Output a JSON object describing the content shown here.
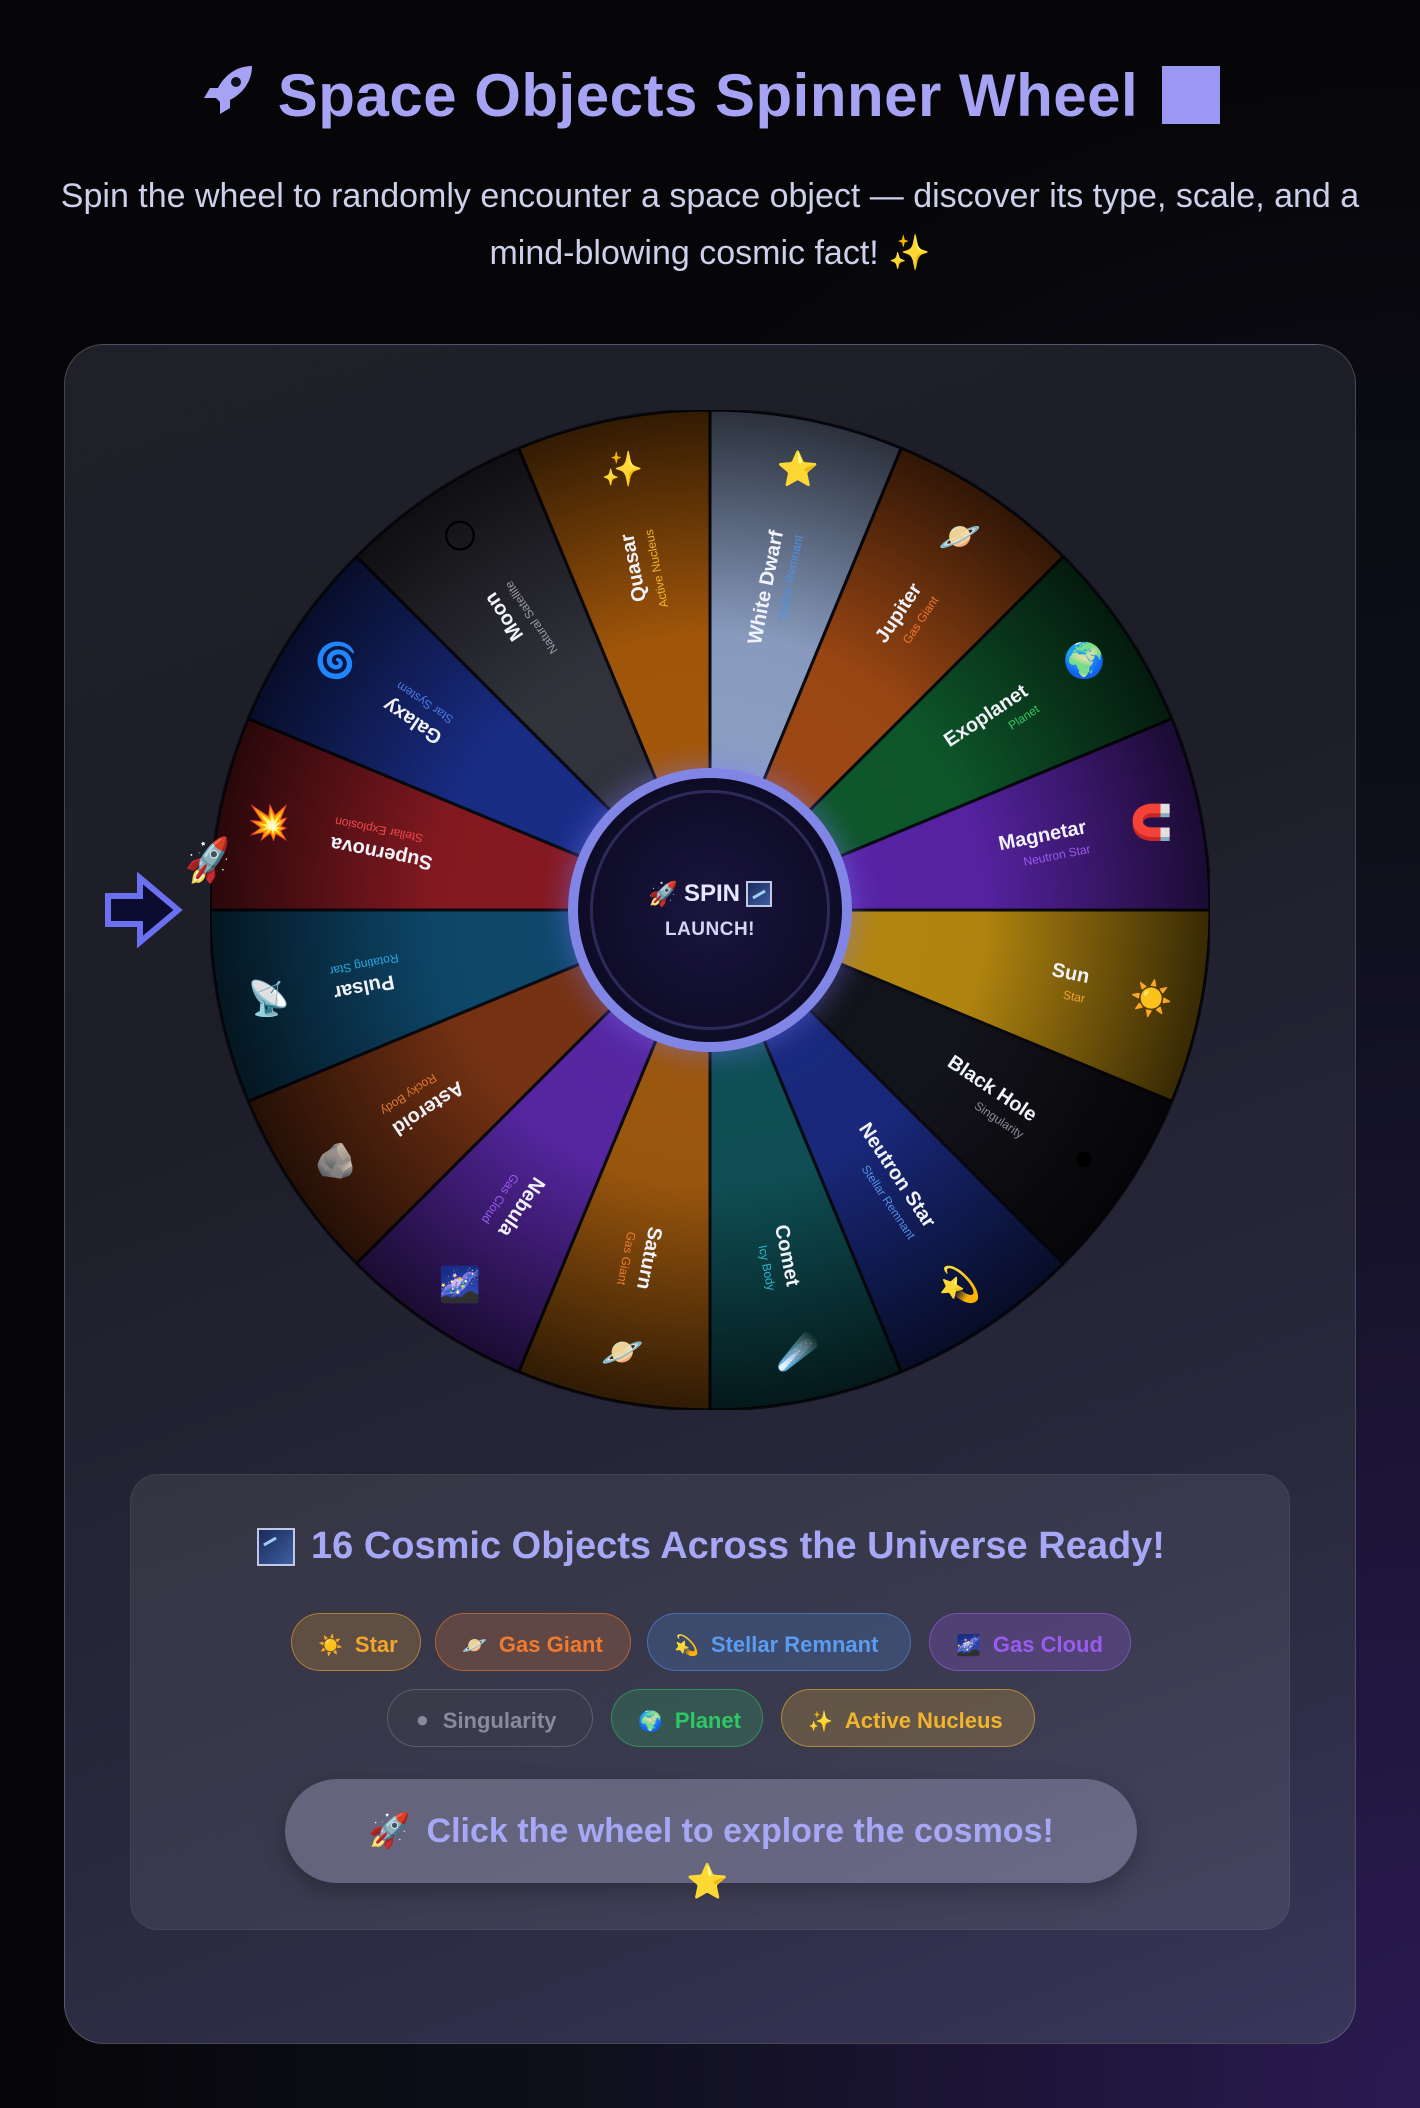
{
  "header": {
    "title_icon": "rocket-icon",
    "title": "Space Objects Spinner Wheel",
    "subtitle": "Spin the wheel to randomly encounter a space object — discover its type, scale, and a mind-blowing cosmic fact! ✨"
  },
  "wheel": {
    "segments": [
      {
        "name": "White Dwarf",
        "type": "Stellar Remnant",
        "icon": "⭐",
        "color": "#8fa3c8",
        "type_color": "#4e8fe6"
      },
      {
        "name": "Jupiter",
        "type": "Gas Giant",
        "icon": "🪐",
        "color": "#a24a14",
        "type_color": "#f07a2e"
      },
      {
        "name": "Exoplanet",
        "type": "Planet",
        "icon": "🌍",
        "color": "#0e5a2c",
        "type_color": "#2ec866"
      },
      {
        "name": "Magnetar",
        "type": "Neutron Star",
        "icon": "🧲",
        "color": "#5a24a8",
        "type_color": "#9a5cf0"
      },
      {
        "name": "Sun",
        "type": "Star",
        "icon": "☀️",
        "color": "#b88a10",
        "type_color": "#f2a62c"
      },
      {
        "name": "Black Hole",
        "type": "Singularity",
        "icon": "⚫",
        "color": "#14141c",
        "type_color": "#8a8a9a"
      },
      {
        "name": "Neutron Star",
        "type": "Stellar Remnant",
        "icon": "💫",
        "color": "#1a2a80",
        "type_color": "#4e8fe6"
      },
      {
        "name": "Comet",
        "type": "Icy Body",
        "icon": "☄️",
        "color": "#0f5258",
        "type_color": "#2ab8d0"
      },
      {
        "name": "Saturn",
        "type": "Gas Giant",
        "icon": "🪐",
        "color": "#a05a0e",
        "type_color": "#f07a2e"
      },
      {
        "name": "Nebula",
        "type": "Gas Cloud",
        "icon": "🌌",
        "color": "#5a28a8",
        "type_color": "#9a5cf0"
      },
      {
        "name": "Asteroid",
        "type": "Rocky Body",
        "icon": "🪨",
        "color": "#7a3414",
        "type_color": "#e07a2e"
      },
      {
        "name": "Pulsar",
        "type": "Rotating Star",
        "icon": "📡",
        "color": "#0e4a6e",
        "type_color": "#2aa8e0"
      },
      {
        "name": "Supernova",
        "type": "Stellar Explosion",
        "icon": "💥",
        "color": "#8a1a22",
        "type_color": "#f04a4a"
      },
      {
        "name": "Galaxy",
        "type": "Star System",
        "icon": "🌀",
        "color": "#1a2e8a",
        "type_color": "#4e7ae6"
      },
      {
        "name": "Moon",
        "type": "Natural Satellite",
        "icon": "🌕",
        "color": "#34343e",
        "type_color": "#9a9aa8"
      },
      {
        "name": "Quasar",
        "type": "Active Nucleus",
        "icon": "✨",
        "color": "#a85a0a",
        "type_color": "#f2b42c"
      }
    ],
    "pointer_icon": "rocket-icon"
  },
  "hub": {
    "spin_label": "SPIN",
    "launch_label": "LAUNCH!"
  },
  "info": {
    "title": "16 Cosmic Objects Across the Universe Ready!",
    "chips": [
      {
        "icon": "☀️",
        "label": "Star",
        "color": "#f2a62c",
        "bg": "rgba(242,166,44,0.22)",
        "border": "rgba(242,166,44,0.55)"
      },
      {
        "icon": "🪐",
        "label": "Gas Giant",
        "color": "#f07a2e",
        "bg": "rgba(240,122,46,0.22)",
        "border": "rgba(240,122,46,0.55)"
      },
      {
        "icon": "💫",
        "label": "Stellar Remnant",
        "color": "#5a9cf0",
        "bg": "rgba(78,143,230,0.22)",
        "border": "rgba(78,143,230,0.55)"
      },
      {
        "icon": "🌌",
        "label": "Gas Cloud",
        "color": "#9a5cf0",
        "bg": "rgba(154,92,240,0.22)",
        "border": "rgba(154,92,240,0.55)"
      },
      {
        "icon": "⚫",
        "label": "Singularity",
        "color": "#8a8a9a",
        "bg": "rgba(60,60,72,0.5)",
        "border": "rgba(138,138,154,0.45)"
      },
      {
        "icon": "🌍",
        "label": "Planet",
        "color": "#2ec866",
        "bg": "rgba(46,200,102,0.2)",
        "border": "rgba(46,200,102,0.5)"
      },
      {
        "icon": "✨",
        "label": "Active Nucleus",
        "color": "#f2b42c",
        "bg": "rgba(242,180,44,0.22)",
        "border": "rgba(242,180,44,0.55)"
      }
    ],
    "cta_icon": "🚀",
    "cta_label": "Click the wheel to explore the cosmos!",
    "bottom_icon": "⭐"
  }
}
